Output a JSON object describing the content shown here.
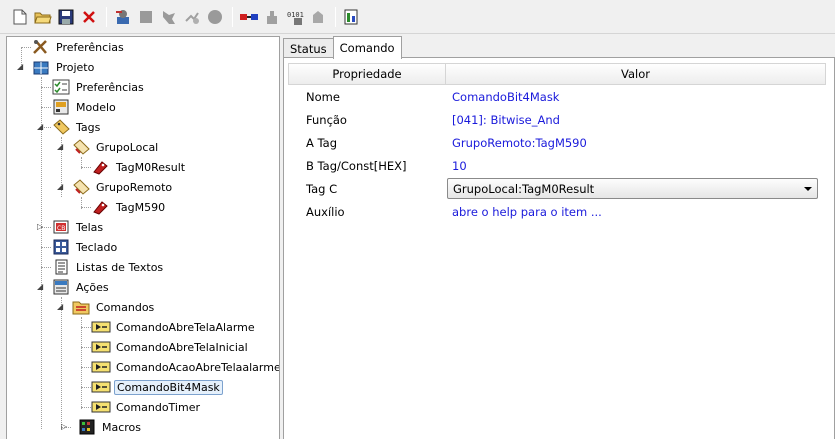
{
  "toolbar": {
    "buttons": [
      {
        "name": "new-document-icon"
      },
      {
        "name": "open-folder-icon"
      },
      {
        "name": "save-icon"
      },
      {
        "name": "delete-icon"
      },
      {
        "name": "tool-a-icon"
      },
      {
        "name": "tool-b-icon"
      },
      {
        "name": "tool-c-icon"
      },
      {
        "name": "tool-d-icon"
      },
      {
        "name": "tool-e-icon"
      },
      {
        "name": "connect-icon"
      },
      {
        "name": "tool-f-icon"
      },
      {
        "name": "tool-g-icon"
      },
      {
        "name": "tool-h-icon"
      },
      {
        "name": "tool-i-icon"
      }
    ]
  },
  "tree": {
    "preferencias_root": "Preferências",
    "projeto": "Projeto",
    "preferencias": "Preferências",
    "modelo": "Modelo",
    "tags": "Tags",
    "grupo_local": "GrupoLocal",
    "tag_m0_result": "TagM0Result",
    "grupo_remoto": "GrupoRemoto",
    "tag_m590": "TagM590",
    "telas": "Telas",
    "teclado": "Teclado",
    "listas_textos": "Listas de Textos",
    "acoes": "Ações",
    "comandos": "Comandos",
    "cmd1": "ComandoAbreTelaAlarme",
    "cmd2": "ComandoAbreTelaInicial",
    "cmd3": "ComandoAcaoAbreTelaalarme",
    "cmd4": "ComandoBit4Mask",
    "cmd5": "ComandoTimer",
    "macros": "Macros"
  },
  "tabs": {
    "status": "Status",
    "comando": "Comando"
  },
  "grid": {
    "header_prop": "Propriedade",
    "header_val": "Valor",
    "rows": [
      {
        "prop": "Nome",
        "val": "ComandoBit4Mask"
      },
      {
        "prop": "Função",
        "val": "[041]: Bitwise_And"
      },
      {
        "prop": "A Tag",
        "val": "GrupoRemoto:TagM590"
      },
      {
        "prop": "B Tag/Const[HEX]",
        "val": "10"
      },
      {
        "prop": "Tag C",
        "val": "GrupoLocal:TagM0Result"
      },
      {
        "prop": "Auxílio",
        "val": "abre o help para o item ..."
      }
    ]
  },
  "colors": {
    "value_text": "#1a1adb",
    "selection_border": "#7da2ce",
    "selection_bg": "#e5f0fb"
  }
}
